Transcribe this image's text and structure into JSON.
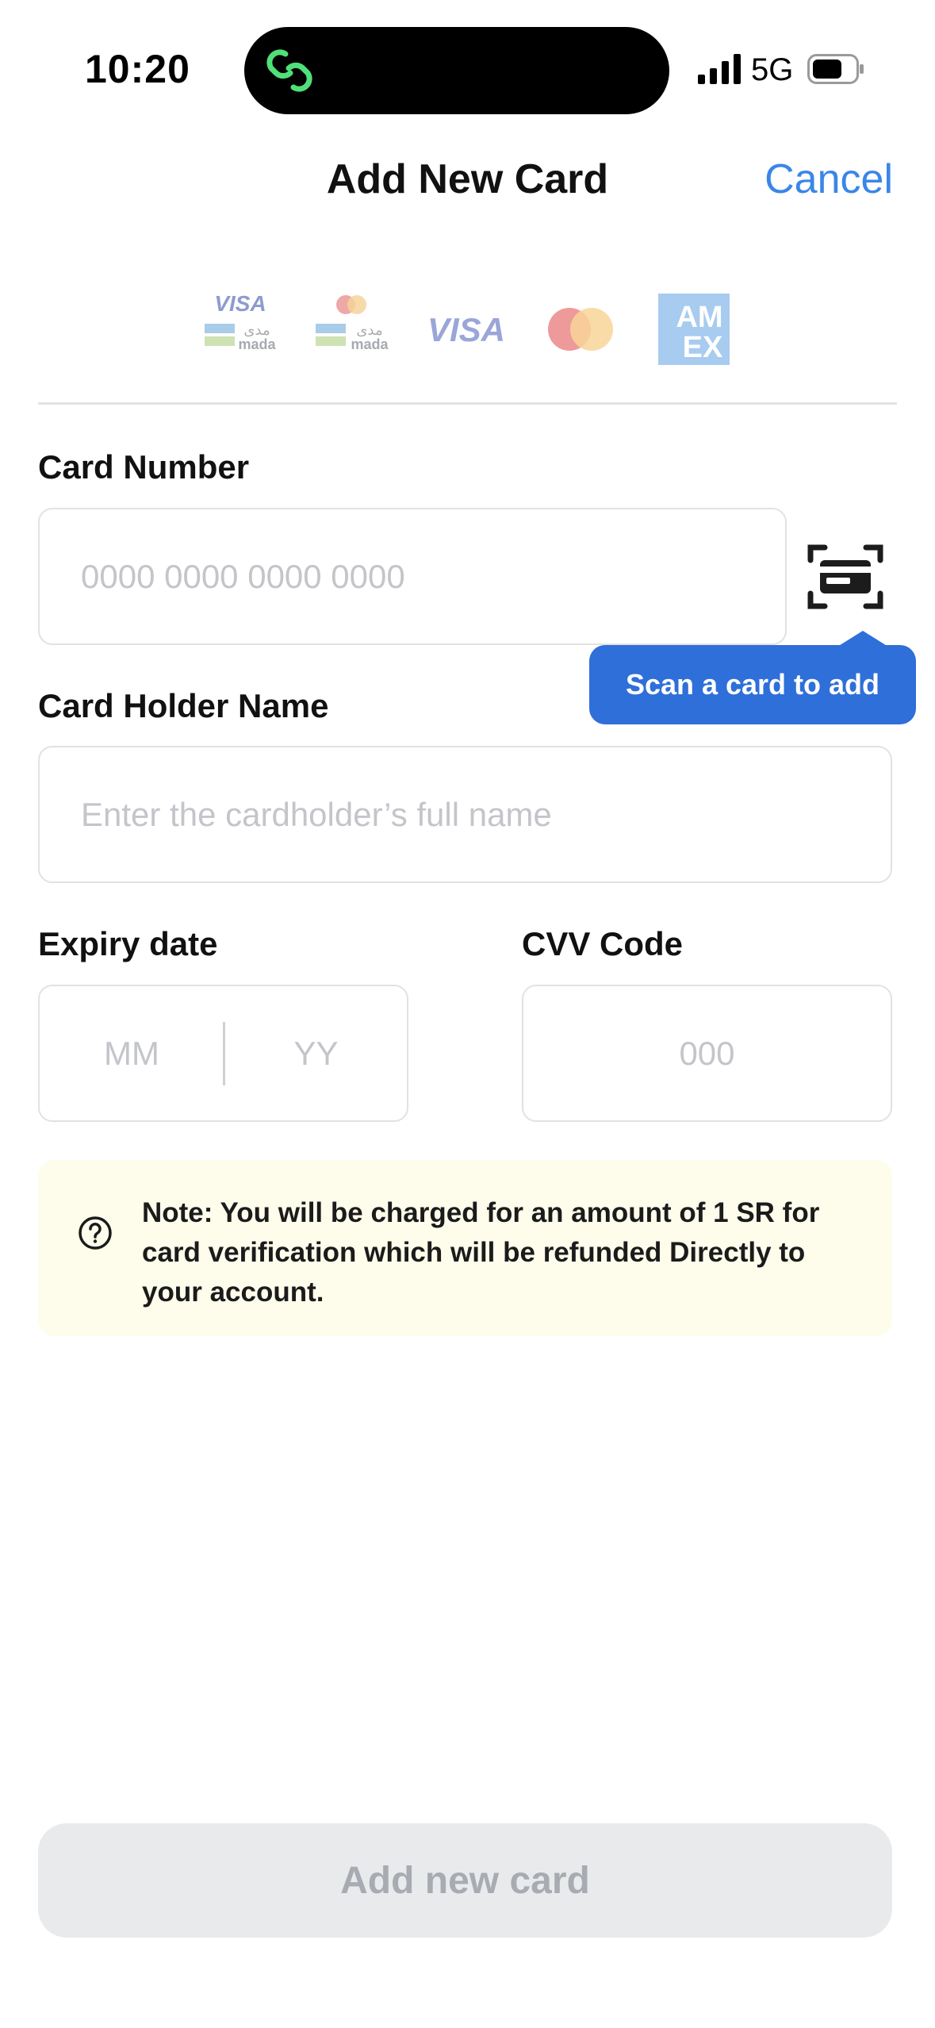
{
  "status_bar": {
    "time": "10:20",
    "network": "5G"
  },
  "nav": {
    "title": "Add New Card",
    "cancel_label": "Cancel"
  },
  "logos": [
    "visa-mada-logo",
    "mastercard-mada-logo",
    "visa-logo",
    "mastercard-logo",
    "amex-logo"
  ],
  "logo_text": {
    "visa": "VISA",
    "mada": "mada",
    "mada_arabic": "مدى",
    "amex_top": "AM",
    "amex_bottom": "EX"
  },
  "card_number": {
    "label": "Card Number",
    "placeholder": "0000 0000 0000 0000"
  },
  "tooltip": {
    "text": "Scan a card to add"
  },
  "holder": {
    "label": "Card Holder Name",
    "placeholder": "Enter the cardholder’s full name"
  },
  "expiry": {
    "label": "Expiry date",
    "month_placeholder": "MM",
    "year_placeholder": "YY"
  },
  "cvv": {
    "label": "CVV Code",
    "placeholder": "000"
  },
  "note": {
    "text": "Note: You will be charged for an amount of 1 SR  for card verification which will be refunded Directly to your account."
  },
  "submit": {
    "label": "Add new card"
  },
  "colors": {
    "accent": "#3a86e8",
    "tooltip": "#2e6fd9",
    "note_bg": "#fefdec",
    "disabled_btn": "#e9eaec"
  }
}
